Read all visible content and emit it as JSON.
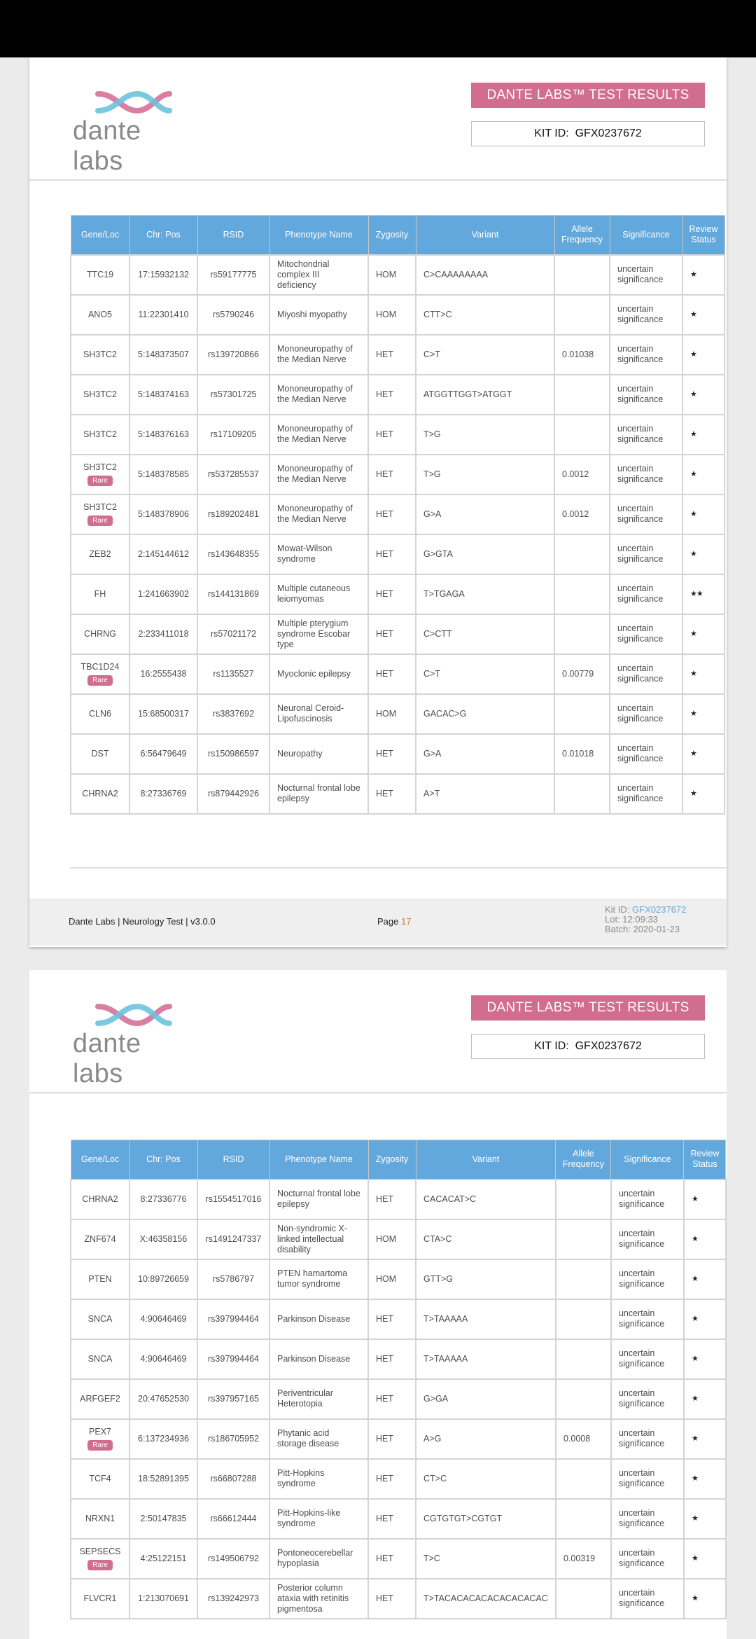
{
  "pages": [
    {
      "logo_text": "dante labs",
      "title": "DANTE LABS™ TEST RESULTS",
      "kit_id_label": "KIT ID:",
      "kit_id": "GFX0237672",
      "columns": [
        "Gene/Loc",
        "Chr: Pos",
        "RSID",
        "Phenotype Name",
        "Zygosity",
        "Variant",
        "Allele Frequency",
        "Significance",
        "Review Status"
      ],
      "rows": [
        {
          "gene": "TTC19",
          "rare": false,
          "pos": "17:15932132",
          "rsid": "rs59177775",
          "phenotype": "Mitochondrial complex III deficiency",
          "zygosity": "HOM",
          "variant": "C>CAAAAAAAA",
          "freq": "",
          "significance": "uncertain significance",
          "review": "★"
        },
        {
          "gene": "ANO5",
          "rare": false,
          "pos": "11:22301410",
          "rsid": "rs5790246",
          "phenotype": "Miyoshi myopathy",
          "zygosity": "HOM",
          "variant": "CTT>C",
          "freq": "",
          "significance": "uncertain significance",
          "review": "★"
        },
        {
          "gene": "SH3TC2",
          "rare": false,
          "pos": "5:148373507",
          "rsid": "rs139720866",
          "phenotype": "Mononeuropathy of the Median Nerve",
          "zygosity": "HET",
          "variant": "C>T",
          "freq": "0.01038",
          "significance": "uncertain significance",
          "review": "★"
        },
        {
          "gene": "SH3TC2",
          "rare": false,
          "pos": "5:148374163",
          "rsid": "rs57301725",
          "phenotype": "Mononeuropathy of the Median Nerve",
          "zygosity": "HET",
          "variant": "ATGGTTGGT>ATGGT",
          "freq": "",
          "significance": "uncertain significance",
          "review": "★"
        },
        {
          "gene": "SH3TC2",
          "rare": false,
          "pos": "5:148376163",
          "rsid": "rs17109205",
          "phenotype": "Mononeuropathy of the Median Nerve",
          "zygosity": "HET",
          "variant": "T>G",
          "freq": "",
          "significance": "uncertain significance",
          "review": "★"
        },
        {
          "gene": "SH3TC2",
          "rare": true,
          "pos": "5:148378585",
          "rsid": "rs537285537",
          "phenotype": "Mononeuropathy of the Median Nerve",
          "zygosity": "HET",
          "variant": "T>G",
          "freq": "0.0012",
          "significance": "uncertain significance",
          "review": "★"
        },
        {
          "gene": "SH3TC2",
          "rare": true,
          "pos": "5:148378906",
          "rsid": "rs189202481",
          "phenotype": "Mononeuropathy of the Median Nerve",
          "zygosity": "HET",
          "variant": "G>A",
          "freq": "0.0012",
          "significance": "uncertain significance",
          "review": "★"
        },
        {
          "gene": "ZEB2",
          "rare": false,
          "pos": "2:145144612",
          "rsid": "rs143648355",
          "phenotype": "Mowat-Wilson syndrome",
          "zygosity": "HET",
          "variant": "G>GTA",
          "freq": "",
          "significance": "uncertain significance",
          "review": "★"
        },
        {
          "gene": "FH",
          "rare": false,
          "pos": "1:241663902",
          "rsid": "rs144131869",
          "phenotype": "Multiple cutaneous leiomyomas",
          "zygosity": "HET",
          "variant": "T>TGAGA",
          "freq": "",
          "significance": "uncertain significance",
          "review": "★★"
        },
        {
          "gene": "CHRNG",
          "rare": false,
          "pos": "2:233411018",
          "rsid": "rs57021172",
          "phenotype": "Multiple pterygium syndrome Escobar type",
          "zygosity": "HET",
          "variant": "C>CTT",
          "freq": "",
          "significance": "uncertain significance",
          "review": "★"
        },
        {
          "gene": "TBC1D24",
          "rare": true,
          "pos": "16:2555438",
          "rsid": "rs1135527",
          "phenotype": "Myoclonic epilepsy",
          "zygosity": "HET",
          "variant": "C>T",
          "freq": "0.00779",
          "significance": "uncertain significance",
          "review": "★"
        },
        {
          "gene": "CLN6",
          "rare": false,
          "pos": "15:68500317",
          "rsid": "rs3837692",
          "phenotype": "Neuronal Ceroid-Lipofuscinosis",
          "zygosity": "HOM",
          "variant": "GACAC>G",
          "freq": "",
          "significance": "uncertain significance",
          "review": "★"
        },
        {
          "gene": "DST",
          "rare": false,
          "pos": "6:56479649",
          "rsid": "rs150986597",
          "phenotype": "Neuropathy",
          "zygosity": "HET",
          "variant": "G>A",
          "freq": "0.01018",
          "significance": "uncertain significance",
          "review": "★"
        },
        {
          "gene": "CHRNA2",
          "rare": false,
          "pos": "8:27336769",
          "rsid": "rs879442926",
          "phenotype": "Nocturnal frontal lobe epilepsy",
          "zygosity": "HET",
          "variant": "A>T",
          "freq": "",
          "significance": "uncertain significance",
          "review": "★"
        }
      ],
      "footer": {
        "left": "Dante Labs | Neurology Test | v3.0.0",
        "page_label": "Page",
        "page_num": "17",
        "kit_label": "Kit ID:",
        "kit_id": "GFX0237672",
        "lot": "Lot: 12:09:33",
        "batch": "Batch: 2020-01-23"
      }
    },
    {
      "logo_text": "dante labs",
      "title": "DANTE LABS™ TEST RESULTS",
      "kit_id_label": "KIT ID:",
      "kit_id": "GFX0237672",
      "columns": [
        "Gene/Loc",
        "Chr: Pos",
        "RSID",
        "Phenotype Name",
        "Zygosity",
        "Variant",
        "Allele Frequency",
        "Significance",
        "Review Status"
      ],
      "rows": [
        {
          "gene": "CHRNA2",
          "rare": false,
          "pos": "8:27336776",
          "rsid": "rs1554517016",
          "phenotype": "Nocturnal frontal lobe epilepsy",
          "zygosity": "HET",
          "variant": "CACACAT>C",
          "freq": "",
          "significance": "uncertain significance",
          "review": "★"
        },
        {
          "gene": "ZNF674",
          "rare": false,
          "pos": "X:46358156",
          "rsid": "rs1491247337",
          "phenotype": "Non-syndromic X-linked intellectual disability",
          "zygosity": "HOM",
          "variant": "CTA>C",
          "freq": "",
          "significance": "uncertain significance",
          "review": "★"
        },
        {
          "gene": "PTEN",
          "rare": false,
          "pos": "10:89726659",
          "rsid": "rs5786797",
          "phenotype": "PTEN hamartoma tumor syndrome",
          "zygosity": "HOM",
          "variant": "GTT>G",
          "freq": "",
          "significance": "uncertain significance",
          "review": "★"
        },
        {
          "gene": "SNCA",
          "rare": false,
          "pos": "4:90646469",
          "rsid": "rs397994464",
          "phenotype": "Parkinson Disease",
          "zygosity": "HET",
          "variant": "T>TAAAAA",
          "freq": "",
          "significance": "uncertain significance",
          "review": "★"
        },
        {
          "gene": "SNCA",
          "rare": false,
          "pos": "4:90646469",
          "rsid": "rs397994464",
          "phenotype": "Parkinson Disease",
          "zygosity": "HET",
          "variant": "T>TAAAAA",
          "freq": "",
          "significance": "uncertain significance",
          "review": "★"
        },
        {
          "gene": "ARFGEF2",
          "rare": false,
          "pos": "20:47652530",
          "rsid": "rs397957165",
          "phenotype": "Periventricular Heterotopia",
          "zygosity": "HET",
          "variant": "G>GA",
          "freq": "",
          "significance": "uncertain significance",
          "review": "★"
        },
        {
          "gene": "PEX7",
          "rare": true,
          "pos": "6:137234936",
          "rsid": "rs186705952",
          "phenotype": "Phytanic acid storage disease",
          "zygosity": "HET",
          "variant": "A>G",
          "freq": "0.0008",
          "significance": "uncertain significance",
          "review": "★"
        },
        {
          "gene": "TCF4",
          "rare": false,
          "pos": "18:52891395",
          "rsid": "rs66807288",
          "phenotype": "Pitt-Hopkins syndrome",
          "zygosity": "HET",
          "variant": "CT>C",
          "freq": "",
          "significance": "uncertain significance",
          "review": "★"
        },
        {
          "gene": "NRXN1",
          "rare": false,
          "pos": "2:50147835",
          "rsid": "rs66612444",
          "phenotype": "Pitt-Hopkins-like syndrome",
          "zygosity": "HET",
          "variant": "CGTGTGT>CGTGT",
          "freq": "",
          "significance": "uncertain significance",
          "review": "★"
        },
        {
          "gene": "SEPSECS",
          "rare": true,
          "pos": "4:25122151",
          "rsid": "rs149506792",
          "phenotype": "Pontoneocerebellar hypoplasia",
          "zygosity": "HET",
          "variant": "T>C",
          "freq": "0.00319",
          "significance": "uncertain significance",
          "review": "★"
        },
        {
          "gene": "FLVCR1",
          "rare": false,
          "pos": "1:213070691",
          "rsid": "rs139242973",
          "phenotype": "Posterior column ataxia with retinitis pigmentosa",
          "zygosity": "HET",
          "variant": "T>TACACACACACACACACAC",
          "freq": "",
          "significance": "uncertain significance",
          "review": "★"
        }
      ]
    }
  ],
  "rare_label": "Rare",
  "colors": {
    "accent_pink": "#d16d8e",
    "header_blue": "#63a8dc",
    "logo_blue": "#6cc3de",
    "logo_pink": "#d87fa3"
  },
  "icons": {
    "logo": "dante-labs-x-logo-icon",
    "review_star": "star-icon"
  }
}
